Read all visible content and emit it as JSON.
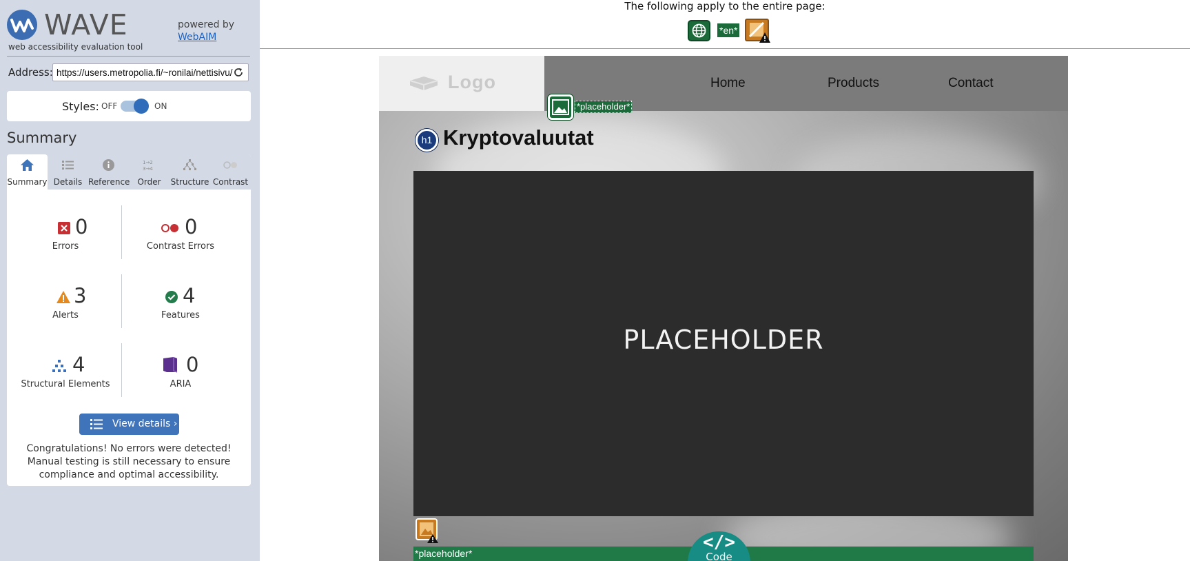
{
  "sidebar": {
    "brand": "WAVE",
    "tagline": "web accessibility evaluation tool",
    "powered_by": "powered by",
    "powered_link": "WebAIM",
    "address_label": "Address:",
    "address_value": "https://users.metropolia.fi/~ronilai/nettisivu/",
    "styles_label": "Styles:",
    "styles_off": "OFF",
    "styles_on": "ON",
    "styles_enabled": true,
    "summary_title": "Summary",
    "tabs": [
      {
        "label": "Summary",
        "icon": "home-icon",
        "active": true
      },
      {
        "label": "Details",
        "icon": "list-icon",
        "active": false
      },
      {
        "label": "Reference",
        "icon": "info-icon",
        "active": false
      },
      {
        "label": "Order",
        "icon": "order-icon",
        "active": false
      },
      {
        "label": "Structure",
        "icon": "structure-icon",
        "active": false
      },
      {
        "label": "Contrast",
        "icon": "contrast-icon",
        "active": false
      }
    ],
    "stats": {
      "errors": {
        "count": "0",
        "label": "Errors",
        "icon": "error-icon",
        "color": "#c62f33"
      },
      "contrast_errors": {
        "count": "0",
        "label": "Contrast Errors",
        "icon": "contrast-error-icon",
        "color": "#c62f33"
      },
      "alerts": {
        "count": "3",
        "label": "Alerts",
        "icon": "alert-icon",
        "color": "#e5891d"
      },
      "features": {
        "count": "4",
        "label": "Features",
        "icon": "feature-icon",
        "color": "#247c4c"
      },
      "structural": {
        "count": "4",
        "label": "Structural Elements",
        "icon": "structure-icon",
        "color": "#3d6fb8"
      },
      "aria": {
        "count": "0",
        "label": "ARIA",
        "icon": "aria-icon",
        "color": "#5b2f8e"
      }
    },
    "view_details": "View details ›",
    "congrats": "Congratulations! No errors were detected! Manual testing is still necessary to ensure compliance and optimal accessibility."
  },
  "page_level": {
    "applies_text": "The following apply to the entire page:",
    "language_badge": "*en*"
  },
  "site": {
    "logo_text": "Logo",
    "nav": [
      "Home",
      "Products",
      "Contact"
    ],
    "image_tag": "*placeholder*",
    "h1_badge": "h1",
    "heading": "Kryptovaluutat",
    "hero_text": "PLACEHOLDER",
    "bottom_tag": "*placeholder*"
  },
  "code_button": {
    "glyph": "</>",
    "label": "Code"
  },
  "colors": {
    "sidebar_bg": "#d3dae5",
    "primary_blue": "#3f73ba",
    "feature_green": "#1b6a3a",
    "code_teal": "#178c84"
  }
}
